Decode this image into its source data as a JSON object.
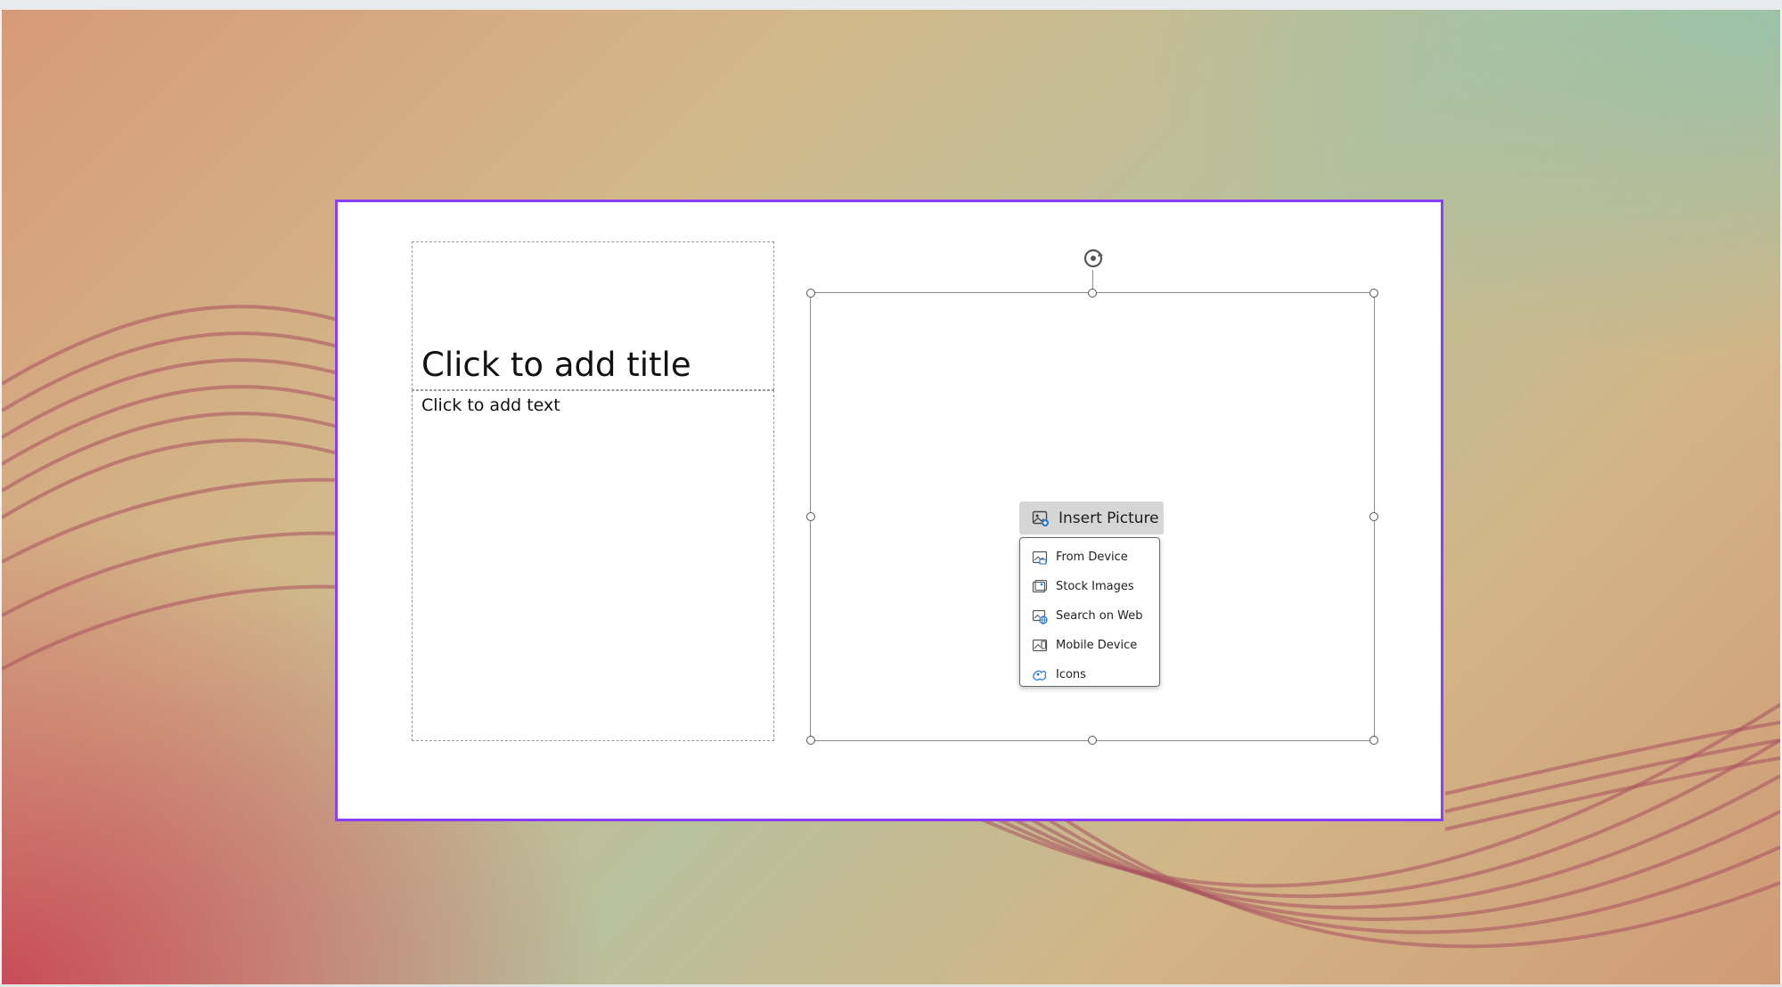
{
  "slide": {
    "title_placeholder": "Click to add title",
    "body_placeholder": "Click to add text"
  },
  "picture_placeholder": {
    "insert_button_label": "Insert Picture",
    "menu_items": [
      {
        "label": "From Device",
        "icon": "from-device-icon"
      },
      {
        "label": "Stock Images",
        "icon": "stock-images-icon"
      },
      {
        "label": "Search on Web",
        "icon": "search-web-icon"
      },
      {
        "label": "Mobile Device",
        "icon": "mobile-device-icon"
      },
      {
        "label": "Icons",
        "icon": "icons-icon"
      }
    ]
  },
  "colors": {
    "selection_border": "#8a3ffc",
    "accent_blue": "#2b7cd3"
  }
}
